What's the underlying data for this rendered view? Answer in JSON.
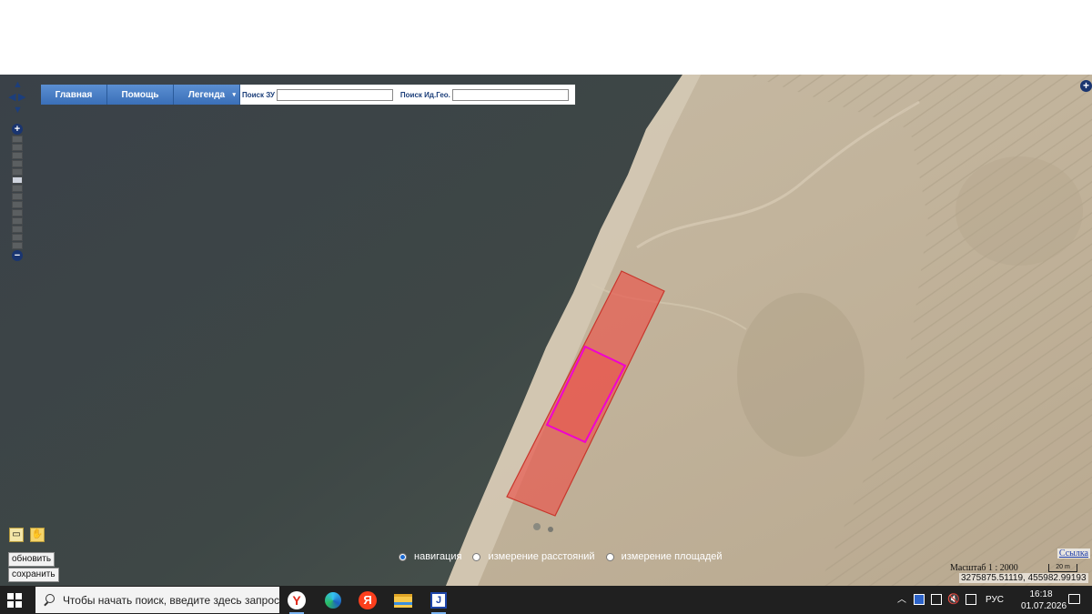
{
  "toolbar": {
    "home_label": "Главная",
    "help_label": "Помощь",
    "legend_label": "Легенда",
    "legend_caret": "▾",
    "search_zu_label": "Поиск ЗУ",
    "search_zu_value": "",
    "search_id_label": "Поиск Ид.Гео.",
    "search_id_value": ""
  },
  "map_controls": {
    "pan_up": "▲",
    "pan_down": "▼",
    "pan_left": "◀",
    "pan_right": "▶",
    "zoom_in": "+",
    "zoom_out": "−",
    "layers_toggle": "+"
  },
  "tools": {
    "refresh_label": "обновить",
    "save_label": "сохранить"
  },
  "modes": [
    {
      "label": "навигация",
      "selected": true
    },
    {
      "label": "измерение расстояний",
      "selected": false
    },
    {
      "label": "измерение площадей",
      "selected": false
    }
  ],
  "map_info": {
    "link_label": "Ссылка",
    "scale_label": "Масштаб 1 : 2000",
    "scale_bar_label": "20 m",
    "coordinates": "3275875.51119, 455982.99193"
  },
  "parcels": {
    "outer_fill": "#e8584f",
    "outer_stroke": "#c8362c",
    "selected_stroke": "#f000d0"
  },
  "taskbar": {
    "search_placeholder": "Чтобы начать поиск, введите здесь запрос",
    "apps": [
      "yandex-browser-icon",
      "edge-icon",
      "yandex-icon",
      "file-explorer-icon",
      "phone-app-icon"
    ],
    "language": "РУС",
    "time": "16:18",
    "date": "01.07.2026"
  }
}
